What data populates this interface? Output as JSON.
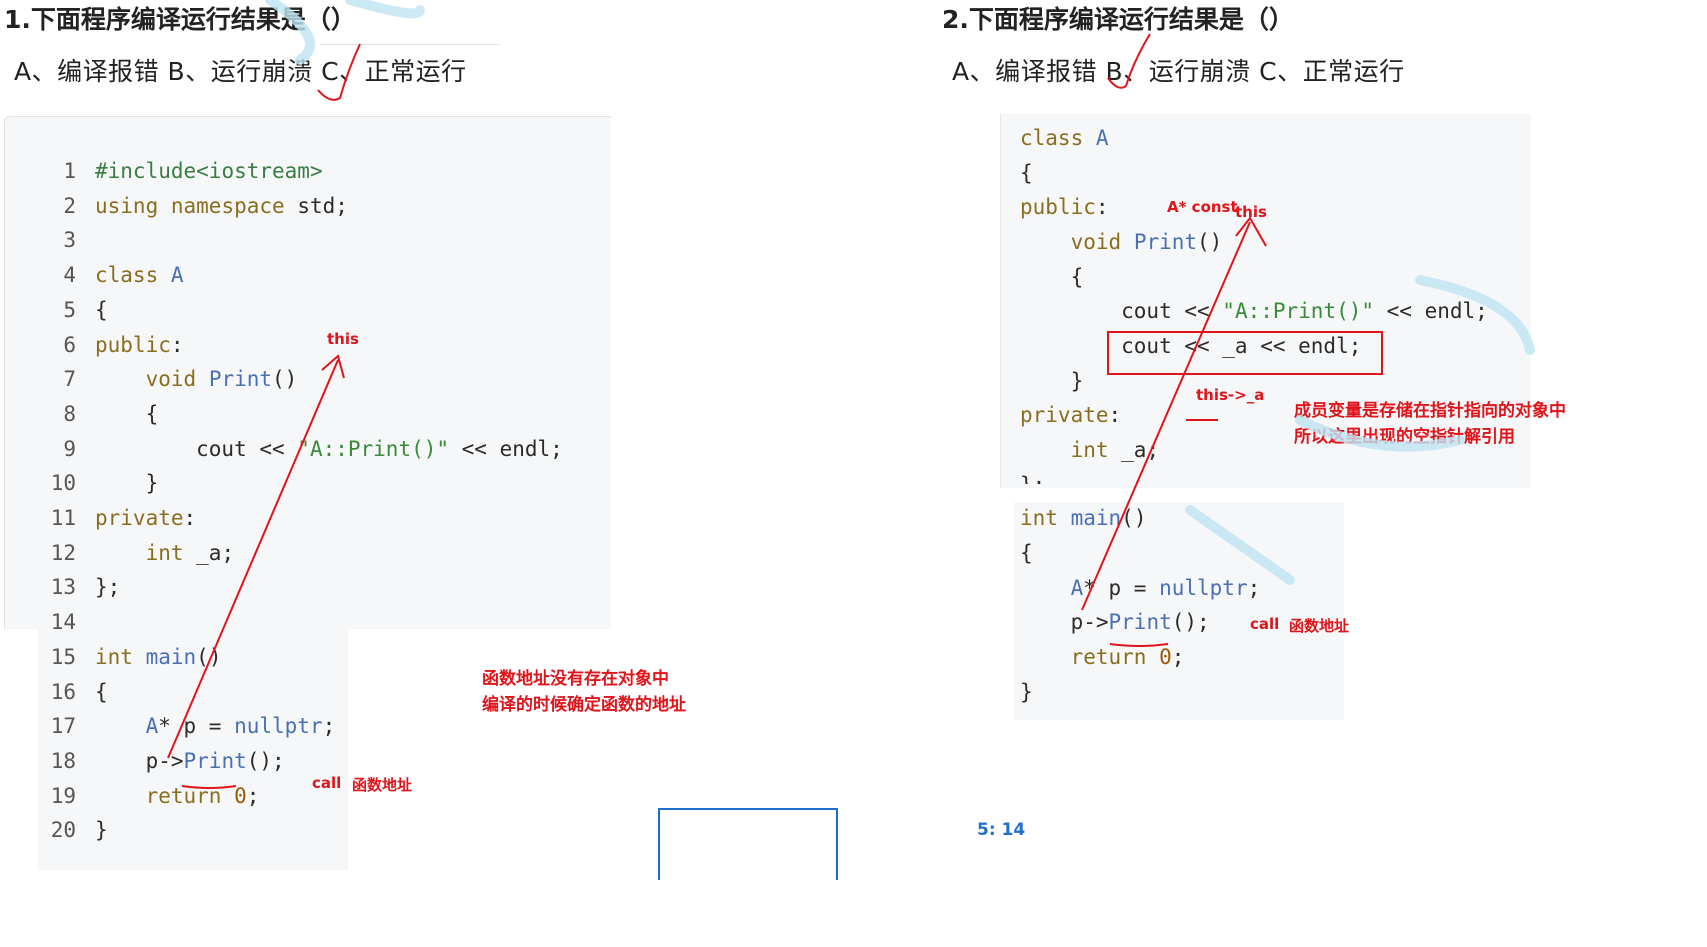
{
  "q1": {
    "title": "1.下面程序编译运行结果是（）",
    "options": "A、编译报错 B、运行崩溃 C、正常运行",
    "code": [
      {
        "n": "1",
        "t": "#include<iostream>"
      },
      {
        "n": "2",
        "t": "using namespace std;"
      },
      {
        "n": "3",
        "t": ""
      },
      {
        "n": "4",
        "t": "class A"
      },
      {
        "n": "5",
        "t": "{"
      },
      {
        "n": "6",
        "t": "public:"
      },
      {
        "n": "7",
        "t": "    void Print()"
      },
      {
        "n": "8",
        "t": "    {"
      },
      {
        "n": "9",
        "t": "        cout << \"A::Print()\" << endl;"
      },
      {
        "n": "10",
        "t": "    }"
      },
      {
        "n": "11",
        "t": "private:"
      },
      {
        "n": "12",
        "t": "    int _a;"
      },
      {
        "n": "13",
        "t": "};"
      },
      {
        "n": "14",
        "t": ""
      },
      {
        "n": "15",
        "t": "int main()"
      },
      {
        "n": "16",
        "t": "{"
      },
      {
        "n": "17",
        "t": "    A* p = nullptr;"
      },
      {
        "n": "18",
        "t": "    p->Print();"
      },
      {
        "n": "19",
        "t": "    return 0;"
      },
      {
        "n": "20",
        "t": "}"
      }
    ],
    "annotations": {
      "this_label": "this",
      "call_label": "call",
      "func_addr_label": "函数地址",
      "note_line1": "函数地址没有存在对象中",
      "note_line2": "编译的时候确定函数的地址"
    }
  },
  "q2": {
    "title": "2.下面程序编译运行结果是（）",
    "options": "A、编译报错 B、运行崩溃 C、正常运行",
    "code": [
      "class A",
      "{",
      "public:",
      "    void Print()",
      "    {",
      "        cout << \"A::Print()\" << endl;",
      "        cout << _a << endl;",
      "    }",
      "private:",
      "    int _a;",
      "};",
      "int main()",
      "{",
      "    A* p = nullptr;",
      "    p->Print();",
      "    return 0;",
      "}"
    ],
    "annotations": {
      "a_const_this": "A* const",
      "this_label": "this",
      "this_a": "this->_a",
      "call_label": "call",
      "func_addr_label": "函数地址",
      "note_line1": "成员变量是存储在指针指向的对象中",
      "note_line2": "所以这里出现的空指针解引用"
    }
  },
  "footer": {
    "timestamp": "5: 14"
  },
  "colors": {
    "annotation_red": "#e0141b",
    "frame_blue": "#1f6fd0",
    "code_bg": "#f6f7f8"
  }
}
